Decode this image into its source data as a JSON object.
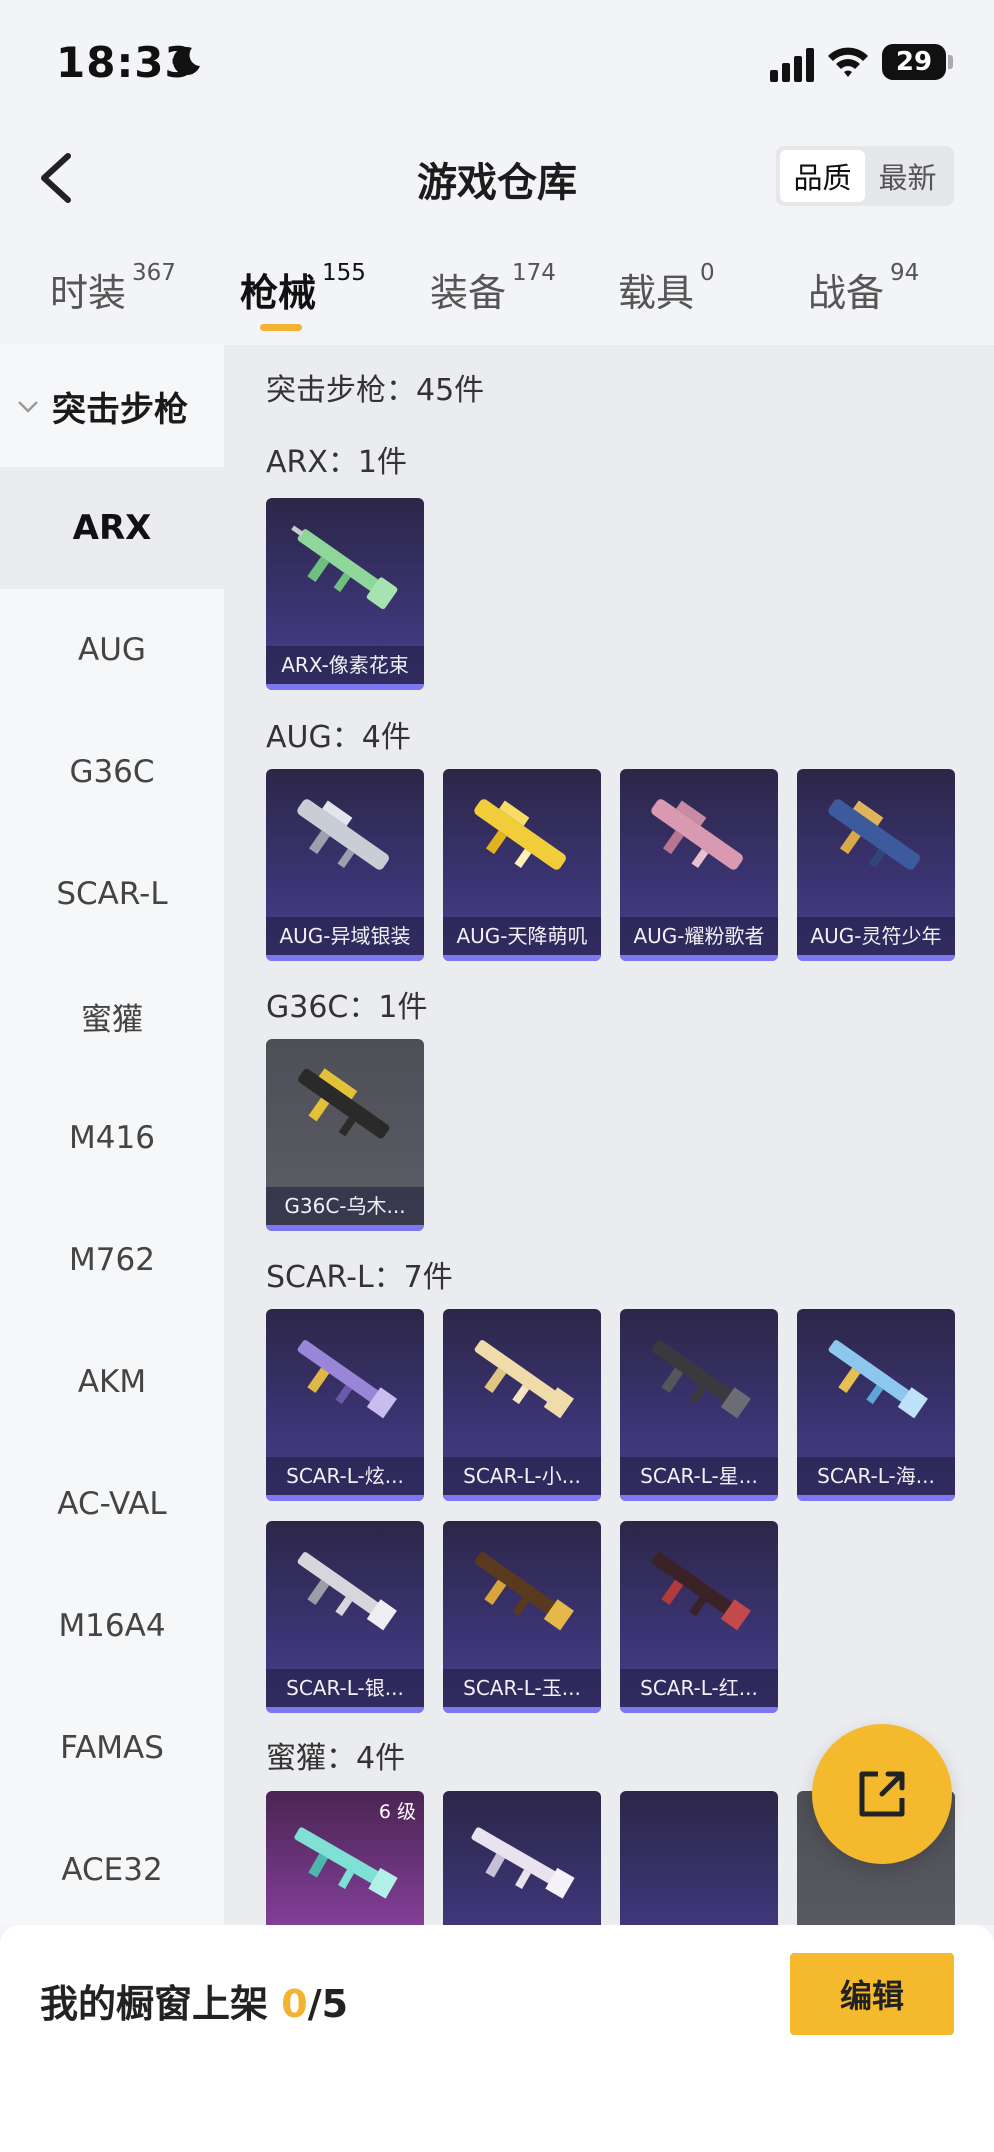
{
  "status_bar": {
    "time": "18:33",
    "battery": "29"
  },
  "header": {
    "title": "游戏仓库",
    "sort_options": [
      "品质",
      "最新"
    ],
    "active_sort": "品质"
  },
  "tabs": [
    {
      "label": "时装",
      "count": "367"
    },
    {
      "label": "枪械",
      "count": "155"
    },
    {
      "label": "装备",
      "count": "174"
    },
    {
      "label": "载具",
      "count": "0"
    },
    {
      "label": "战备",
      "count": "94"
    }
  ],
  "active_tab": "枪械",
  "sidebar": {
    "group": "突击步枪",
    "items": [
      "ARX",
      "AUG",
      "G36C",
      "SCAR-L",
      "蜜獾",
      "M416",
      "M762",
      "AKM",
      "AC-VAL",
      "M16A4",
      "FAMAS",
      "ACE32"
    ],
    "active": "ARX"
  },
  "content": {
    "total": "突击步枪：45件",
    "sections": [
      {
        "label": "ARX：1件",
        "items": [
          "ARX-像素花束"
        ]
      },
      {
        "label": "AUG：4件",
        "items": [
          "AUG-异域银装",
          "AUG-天降萌叽",
          "AUG-耀粉歌者",
          "AUG-灵符少年"
        ]
      },
      {
        "label": "G36C：1件",
        "items": [
          "G36C-乌木..."
        ]
      },
      {
        "label": "SCAR-L：7件",
        "items": [
          "SCAR-L-炫...",
          "SCAR-L-小...",
          "SCAR-L-星...",
          "SCAR-L-海...",
          "SCAR-L-银...",
          "SCAR-L-玉...",
          "SCAR-L-红..."
        ]
      },
      {
        "label": "蜜獾：4件",
        "items": [
          "",
          "",
          "",
          ""
        ],
        "first_level": "6 级"
      }
    ]
  },
  "bottom_bar": {
    "shelf_label": "我的橱窗上架 ",
    "shelf_used": "0",
    "shelf_total": "/5",
    "edit_label": "编辑"
  },
  "colors": {
    "accent": "#f5b92e",
    "card_bar": "#7b78f0"
  }
}
